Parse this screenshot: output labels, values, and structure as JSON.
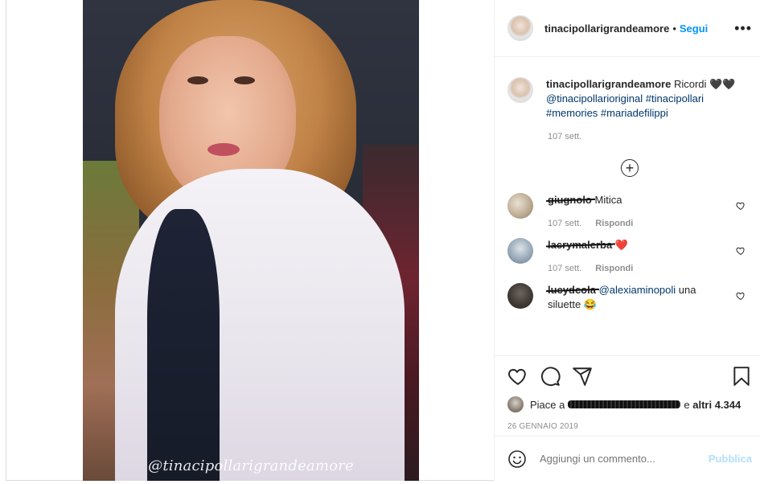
{
  "post": {
    "watermark": "@tinacipollarigrandeamore"
  },
  "header": {
    "username": "tinacipollarigrandeamore",
    "separator": "•",
    "follow_label": "Segui",
    "more_label": "•••"
  },
  "caption": {
    "username": "tinacipollarigrandeamore",
    "text": "Ricordi 🖤🖤",
    "mention": "@tinacipollarioriginal",
    "tags": [
      "#tinacipollari",
      "#memories",
      "#mariadefilippi"
    ],
    "time": "107 sett."
  },
  "load_more_label": "+",
  "comments": [
    {
      "username": "giugnolo",
      "text": "Mitica",
      "time": "107 sett.",
      "reply_label": "Rispondi"
    },
    {
      "username": "lacrymalerba",
      "text": "❤️",
      "time": "107 sett.",
      "reply_label": "Rispondi"
    },
    {
      "username": "lucydcola",
      "mention": "@alexiaminopoli",
      "text": "una siluette 😂"
    }
  ],
  "likes": {
    "prefix": "Piace a",
    "suffix": "e",
    "others": "altri 4.344"
  },
  "date": "26 GENNAIO 2019",
  "add_comment": {
    "placeholder": "Aggiungi un commento...",
    "publish_label": "Pubblica"
  },
  "colors": {
    "accent": "#0095f6",
    "publish_disabled": "#b2dffc",
    "muted": "#8e8e8e",
    "link": "#00376b",
    "heart": "#ed4956"
  }
}
